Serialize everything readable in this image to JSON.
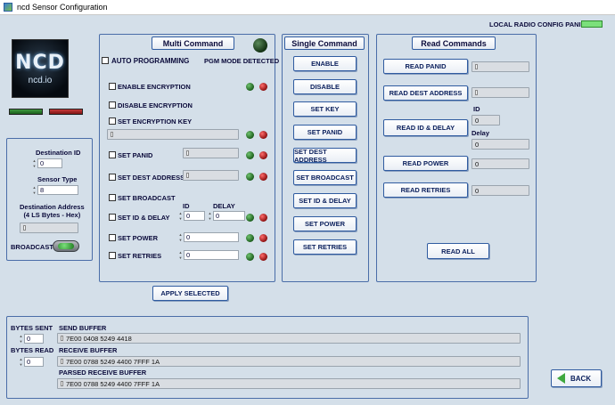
{
  "window": {
    "title": "ncd Sensor Configuration"
  },
  "header": {
    "local_radio_label": "LOCAL RADIO CONFIG PANID"
  },
  "logo": {
    "brand": "NCD",
    "site": "ncd.io"
  },
  "left": {
    "destination_id_label": "Destination ID",
    "destination_id": "0",
    "sensor_type_label": "Sensor Type",
    "sensor_type": "8",
    "destination_address_label": "Destination Address\n(4 LS Bytes - Hex)",
    "destination_address": "",
    "broadcast_label": "BROADCAST"
  },
  "multi": {
    "title": "Multi Command",
    "auto_programming": "AUTO PROGRAMMING",
    "pgm_mode": "PGM MODE DETECTED",
    "enable_encryption": "ENABLE ENCRYPTION",
    "disable_encryption": "DISABLE ENCRYPTION",
    "set_encryption_key": "SET ENCRYPTION KEY",
    "encryption_key": "",
    "set_panid": "SET PANID",
    "panid": "",
    "set_dest_address": "SET DEST ADDRESS",
    "dest_address": "",
    "set_broadcast": "SET BROADCAST",
    "id_label": "ID",
    "delay_label": "DELAY",
    "set_id_delay": "SET ID & DELAY",
    "id_value": "0",
    "delay_value": "0",
    "set_power": "SET POWER",
    "power_value": "0",
    "set_retries": "SET RETRIES",
    "retries_value": "0",
    "apply_selected": "APPLY SELECTED"
  },
  "single": {
    "title": "Single Command",
    "buttons": [
      "ENABLE",
      "DISABLE",
      "SET KEY",
      "SET PANID",
      "SET DEST ADDRESS",
      "SET BROADCAST",
      "SET ID & DELAY",
      "SET POWER",
      "SET RETRIES"
    ]
  },
  "read": {
    "title": "Read Commands",
    "read_panid": "READ PANID",
    "panid_value": "",
    "read_dest_address": "READ DEST ADDRESS",
    "dest_value": "",
    "read_id_delay": "READ ID & DELAY",
    "id_label": "ID",
    "id_value": "0",
    "delay_label": "Delay",
    "delay_value": "0",
    "read_power": "READ POWER",
    "power_value": "0",
    "read_retries": "READ RETRIES",
    "retries_value": "0",
    "read_all": "READ ALL"
  },
  "bottom": {
    "bytes_sent_label": "BYTES SENT",
    "bytes_sent": "0",
    "bytes_read_label": "BYTES READ",
    "bytes_read": "0",
    "send_buffer_label": "SEND BUFFER",
    "send_buffer": "7E00 0408 5249 4418",
    "receive_buffer_label": "RECEIVE BUFFER",
    "receive_buffer": "7E00 0788 5249 4400 7FFF 1A",
    "parsed_label": "PARSED RECEIVE BUFFER",
    "parsed_buffer": "7E00 0788 5249 4400 7FFF 1A",
    "back": "BACK"
  }
}
